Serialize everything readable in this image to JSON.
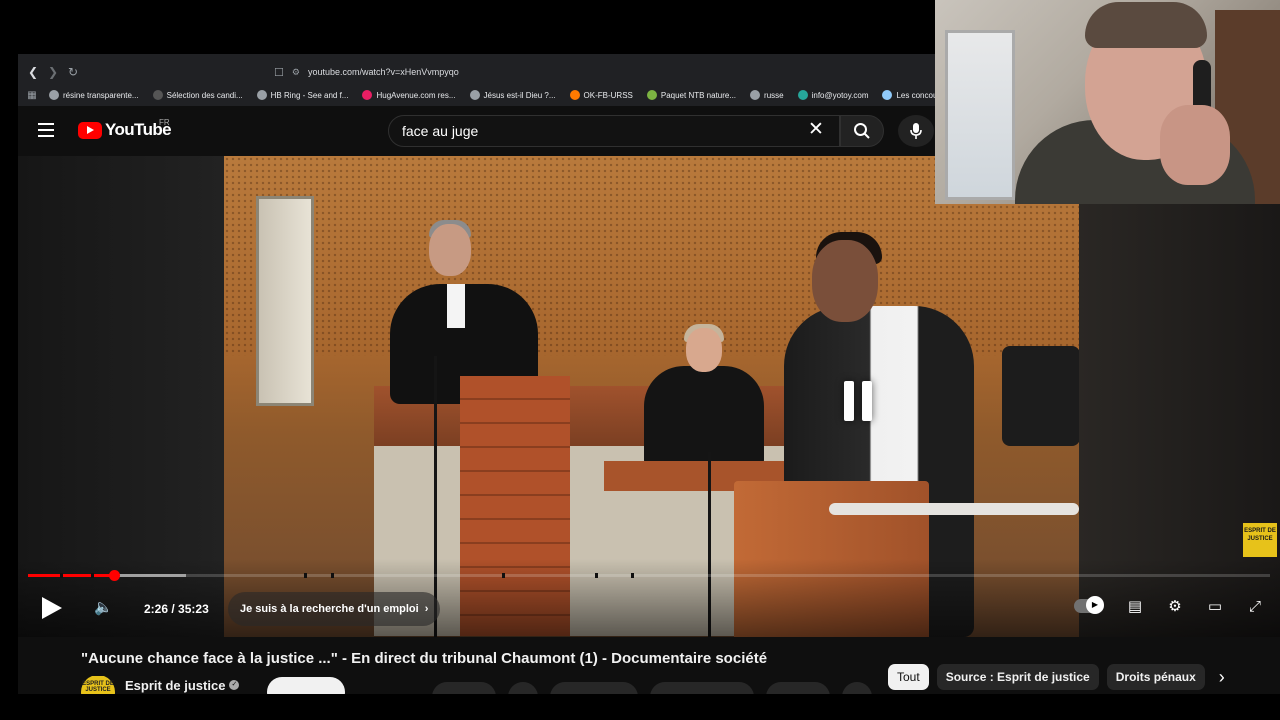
{
  "browser": {
    "url": "youtube.com/watch?v=xHenVvmpyqo",
    "bookmarks": [
      {
        "label": "résine transparente...",
        "color": "#9aa0a6"
      },
      {
        "label": "Sélection des candi...",
        "color": "#555555"
      },
      {
        "label": "HB Ring - See and f...",
        "color": "#9aa0a6"
      },
      {
        "label": "HugAvenue.com res...",
        "color": "#e91e63"
      },
      {
        "label": "Jésus est-il Dieu ?...",
        "color": "#9aa0a6"
      },
      {
        "label": "OK-FB-URSS",
        "color": "#ff7a00"
      },
      {
        "label": "Paquet NTB nature...",
        "color": "#7cb342"
      },
      {
        "label": "russe",
        "color": "#9aa0a6"
      },
      {
        "label": "info@yotoy.com",
        "color": "#26a69a"
      },
      {
        "label": "Les concours",
        "color": "#90caf9"
      }
    ]
  },
  "header": {
    "logo_text": "YouTube",
    "country_code": "FR",
    "search_value": "face au juge"
  },
  "player": {
    "current_time": "2:26",
    "separator": " / ",
    "duration": "35:23",
    "progress_fraction": 0.069,
    "chapter_label": "Je suis à la recherche d'un emploi",
    "channel_bug_text": "ESPRIT DE JUSTICE",
    "state": "paused"
  },
  "video": {
    "title": "\"Aucune chance face à la justice ...\" - En direct du tribunal Chaumont (1) - Documentaire société",
    "channel_name": "Esprit de justice",
    "channel_avatar_text": "ESPRIT DE JUSTICE"
  },
  "chips": {
    "items": [
      "Tout",
      "Source : Esprit de justice",
      "Droits pénaux"
    ],
    "active_index": 0
  },
  "colors": {
    "brand_red": "#ff0000",
    "background": "#0f0f0f",
    "channel_yellow": "#e7c21a"
  }
}
